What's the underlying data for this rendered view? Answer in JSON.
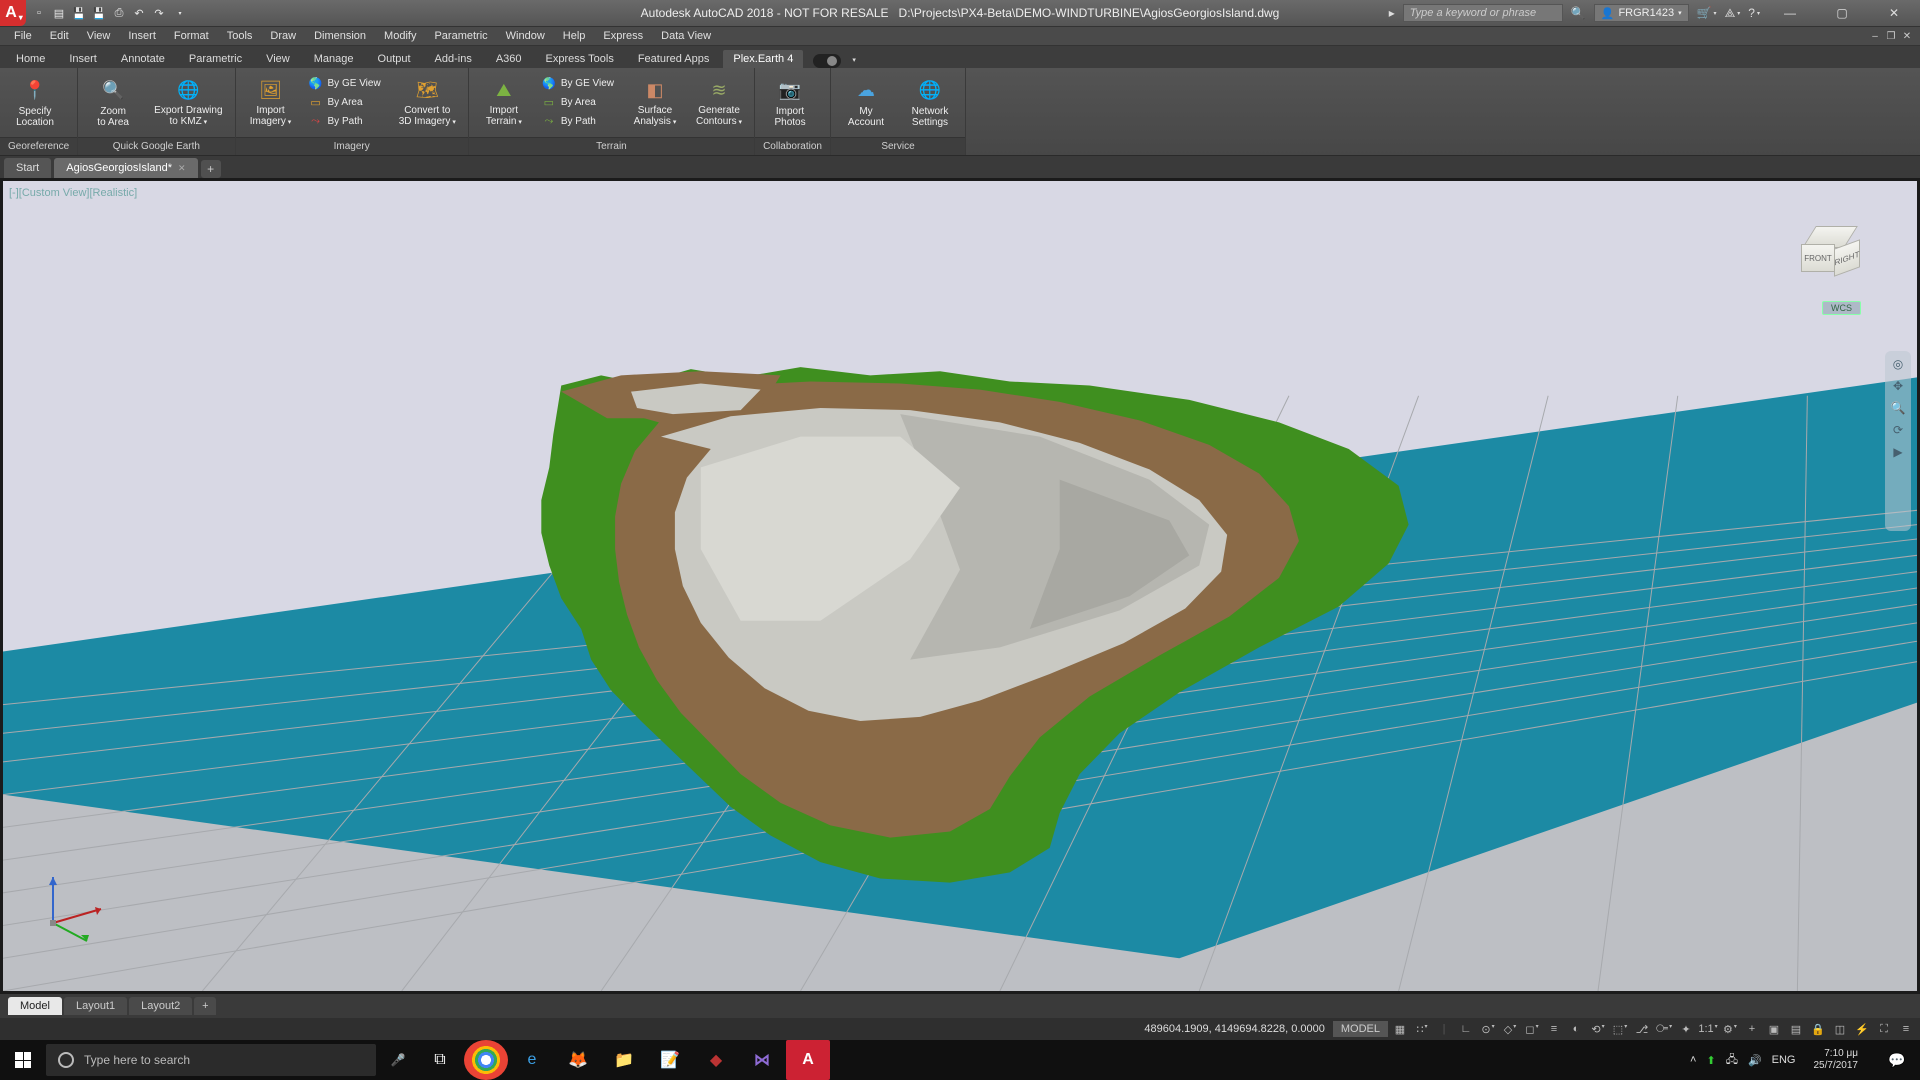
{
  "title": {
    "app": "Autodesk AutoCAD 2018 - NOT FOR RESALE",
    "path": "D:\\Projects\\PX4-Beta\\DEMO-WINDTURBINE\\AgiosGeorgiosIsland.dwg",
    "search_placeholder": "Type a keyword or phrase",
    "user": "FRGR1423"
  },
  "menubar": [
    "File",
    "Edit",
    "View",
    "Insert",
    "Format",
    "Tools",
    "Draw",
    "Dimension",
    "Modify",
    "Parametric",
    "Window",
    "Help",
    "Express",
    "Data View"
  ],
  "ribtabs": [
    "Home",
    "Insert",
    "Annotate",
    "Parametric",
    "View",
    "Manage",
    "Output",
    "Add-ins",
    "A360",
    "Express Tools",
    "Featured Apps",
    "Plex.Earth 4"
  ],
  "ribtab_active": "Plex.Earth 4",
  "ribbon": {
    "georeference": {
      "label": "Georeference",
      "specify": "Specify\nLocation"
    },
    "quick_ge": {
      "label": "Quick Google Earth",
      "zoom": "Zoom\nto Area",
      "export": "Export Drawing\nto KMZ"
    },
    "imagery": {
      "label": "Imagery",
      "import": "Import\nImagery",
      "by_ge": "By GE View",
      "by_area": "By Area",
      "by_path": "By Path",
      "convert": "Convert to\n3D Imagery"
    },
    "terrain": {
      "label": "Terrain",
      "import": "Import\nTerrain",
      "by_ge": "By GE View",
      "by_area": "By Area",
      "by_path": "By Path",
      "surface": "Surface\nAnalysis",
      "contours": "Generate\nContours"
    },
    "collab": {
      "label": "Collaboration",
      "photos": "Import\nPhotos"
    },
    "service": {
      "label": "Service",
      "account": "My\nAccount",
      "settings": "Network\nSettings"
    }
  },
  "doctabs": {
    "start": "Start",
    "file": "AgiosGeorgiosIsland*"
  },
  "viewport": {
    "label": "[-][Custom View][Realistic]",
    "cube_front": "FRONT",
    "cube_right": "RIGHT",
    "wcs": "WCS"
  },
  "layouttabs": [
    "Model",
    "Layout1",
    "Layout2"
  ],
  "statusbar": {
    "coords": "489604.1909, 4149694.8228, 0.0000",
    "model": "MODEL",
    "scale": "1:1"
  },
  "taskbar": {
    "search_placeholder": "Type here to search",
    "lang": "ENG",
    "time": "7:10 μμ",
    "date": "25/7/2017"
  }
}
